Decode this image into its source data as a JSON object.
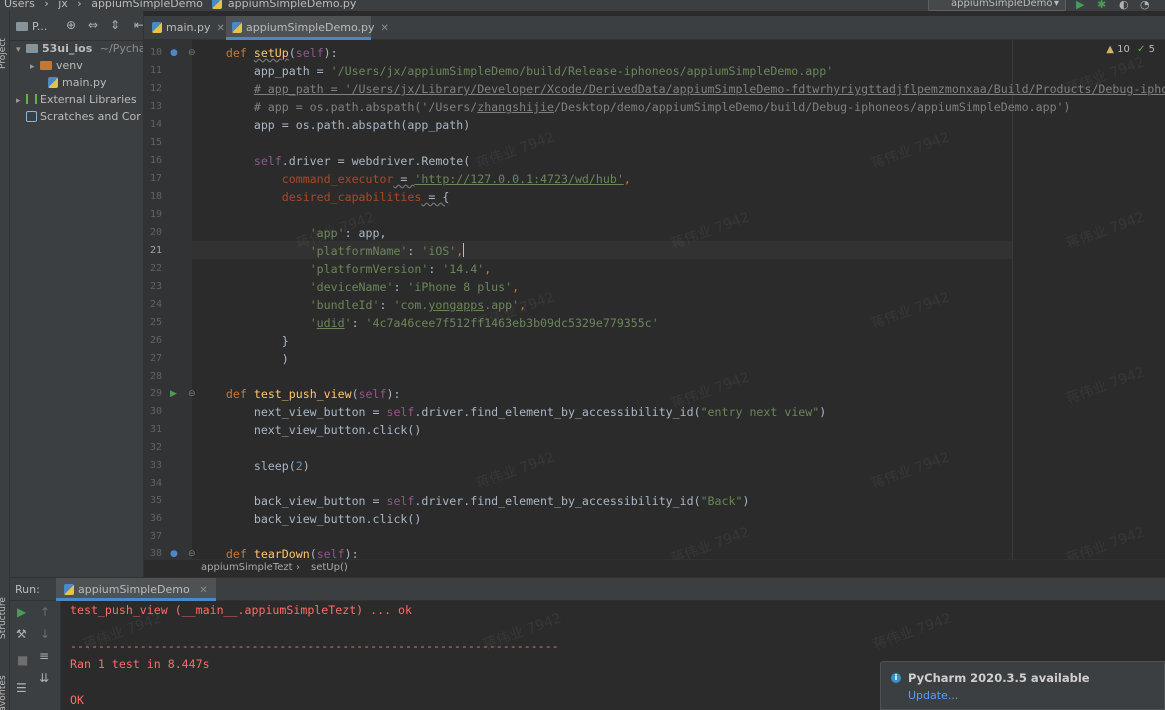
{
  "nav_bar": {
    "breadcrumb": [
      "Users",
      "jx",
      "appiumSimpleDemo",
      "appiumSimpleDemo.py"
    ],
    "run_config": "appiumSimpleDemo"
  },
  "side_strip": {
    "project_label": "Project",
    "structure_label": "Structure",
    "favorites_label": "Favorites"
  },
  "project": {
    "header": "P...",
    "tree": [
      {
        "name": "53ui_ios",
        "path": "~/Pycha"
      },
      {
        "name": "venv"
      },
      {
        "name": "main.py"
      },
      {
        "name": "External Libraries"
      },
      {
        "name": "Scratches and Cor"
      }
    ]
  },
  "tabs": [
    {
      "label": "main.py"
    },
    {
      "label": "appiumSimpleDemo.py"
    }
  ],
  "inspections": {
    "warnings": "10",
    "ok": "5"
  },
  "editor": {
    "current_line": 21,
    "line_numbers": [
      "10",
      "11",
      "12",
      "13",
      "14",
      "15",
      "16",
      "17",
      "18",
      "19",
      "20",
      "21",
      "22",
      "23",
      "24",
      "25",
      "26",
      "27",
      "28",
      "29",
      "30",
      "31",
      "32",
      "33",
      "34",
      "35",
      "36",
      "37",
      "38"
    ]
  },
  "code": {
    "l10_def": "def",
    "l10_fn": "setUp",
    "l10_self": "self",
    "l11_a": "app_path = ",
    "l11_s": "'/Users/jx/appiumSimpleDemo/build/Release-iphoneos/appiumSimpleDemo.app'",
    "l12": "# app_path = '/Users/jx/Library/Developer/Xcode/DerivedData/appiumSimpleDemo-fdtwrhyriygttadjflpemzmonxaa/Build/Products/Debug-iphoneo",
    "l13_a": "# app = os.path.abspath('/Users/",
    "l13_b": "zhangshijie",
    "l13_c": "/Desktop/demo/appiumSimpleDemo/build/Debug-iphoneos/appiumSimpleDemo.app')",
    "l14": "app = os.path.abspath(app_path)",
    "l16_self": "self",
    "l16_b": ".driver = webdriver.Remote(",
    "l17_p": "command_executor",
    "l17_eq": " = ",
    "l17_url": "'http://127.0.0.1:4723/wd/hub'",
    "l17_c": ",",
    "l18_p": "desired_capabilities",
    "l18_eq": " = {",
    "l20_k": "'app'",
    "l20_v": ": app,",
    "l21_k": "'platformName'",
    "l21_m": ": ",
    "l21_v": "'iOS'",
    "l21_c": ",",
    "l22_k": "'platformVersion'",
    "l22_m": ": ",
    "l22_v": "'14.4'",
    "l22_c": ",",
    "l23_k": "'deviceName'",
    "l23_m": ": ",
    "l23_v": "'iPhone 8 plus'",
    "l23_c": ",",
    "l24_k": "'bundleId'",
    "l24_m": ": ",
    "l24_v1": "'com.",
    "l24_v2": "yongapps",
    "l24_v3": ".app'",
    "l24_c": ",",
    "l25_k1": "'",
    "l25_k2": "udid",
    "l25_k3": "'",
    "l25_m": ": ",
    "l25_v": "'4c7a46cee7f512ff1463eb3b09dc5329e779355c'",
    "l26": "}",
    "l27": ")",
    "l29_def": "def",
    "l29_fn": "test_push_view",
    "l29_self": "self",
    "l30_a": "next_view_button = ",
    "l30_self": "self",
    "l30_b": ".driver.find_element_by_accessibility_id(",
    "l30_s": "\"entry next view\"",
    "l30_c": ")",
    "l31": "next_view_button.click()",
    "l33_a": "sleep(",
    "l33_n": "2",
    "l33_c": ")",
    "l35_a": "back_view_button = ",
    "l35_self": "self",
    "l35_b": ".driver.find_element_by_accessibility_id(",
    "l35_s": "\"Back\"",
    "l35_c": ")",
    "l36": "back_view_button.click()",
    "l38_def": "def",
    "l38_fn": "tearDown",
    "l38_self": "self"
  },
  "editor_breadcrumb": [
    "appiumSimpleTezt",
    "setUp()"
  ],
  "run_panel": {
    "label": "Run:",
    "tab": "appiumSimpleDemo",
    "console": [
      "test_push_view (__main__.appiumSimpleTezt) ... ok",
      "",
      "----------------------------------------------------------------------",
      "Ran 1 test in 8.447s",
      "",
      "OK"
    ]
  },
  "notification": {
    "title": "PyCharm 2020.3.5 available",
    "link": "Update..."
  },
  "watermark": "蒋伟业 7942",
  "colors": {
    "keyword": "#cc7832",
    "function": "#ffc66d",
    "string": "#6a8759",
    "self": "#94558d",
    "comment": "#808080",
    "console_error": "#ff6b68",
    "link": "#589df6"
  }
}
